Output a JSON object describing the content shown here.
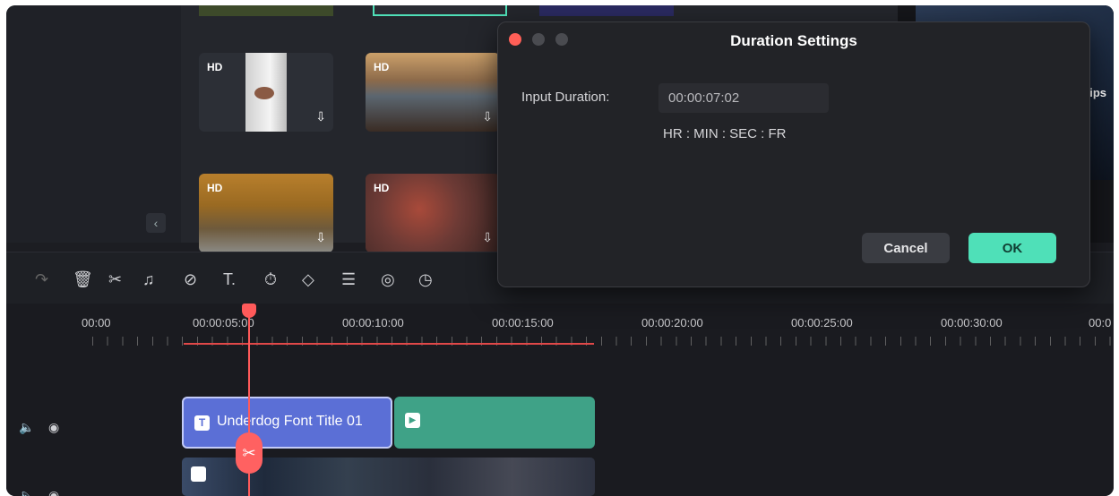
{
  "media": {
    "badge": "HD",
    "download_glyph": "⇩",
    "collapse_glyph": "‹",
    "preview_text": "n ips"
  },
  "toolbar": {
    "icons": [
      "undo-icon",
      "redo-icon",
      "delete-icon",
      "cut-icon",
      "audio-icon",
      "tag-icon",
      "text-icon",
      "speed-icon",
      "keyframe-icon",
      "adjust-icon",
      "color-icon",
      "duration-icon"
    ]
  },
  "timeline": {
    "ruler": [
      "00:00",
      "00:00:05:00",
      "00:00:10:00",
      "00:00:15:00",
      "00:00:20:00",
      "00:00:25:00",
      "00:00:30:00",
      "00:0"
    ],
    "title_clip_label": "Underdog Font Title 01",
    "title_clip_icon": "T",
    "scissors_glyph": "✂",
    "speaker_glyph": "🔈",
    "eye_glyph": "◉"
  },
  "dialog": {
    "title": "Duration Settings",
    "label": "Input Duration:",
    "value": "00:00:07:02",
    "hint": "HR : MIN : SEC : FR",
    "cancel": "Cancel",
    "ok": "OK"
  },
  "colors": {
    "accent": "#4fe0b8",
    "playhead": "#ff5a5a",
    "title_clip": "#5b6fd6",
    "green_clip": "#3fa287"
  }
}
